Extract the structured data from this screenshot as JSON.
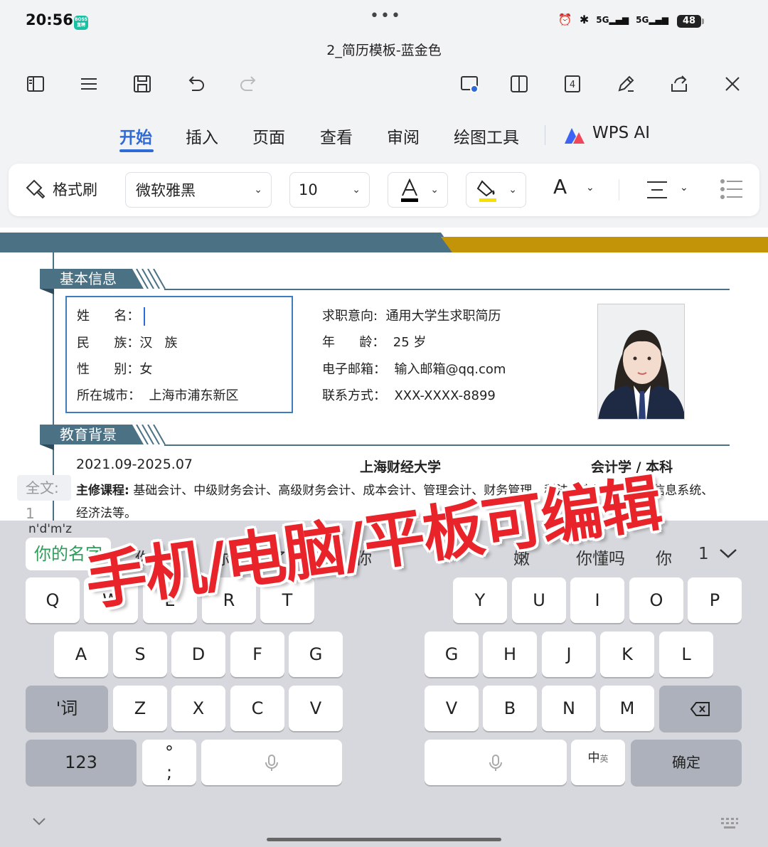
{
  "status": {
    "time": "20:56",
    "app_badge": "BOSS直聘",
    "battery": "48",
    "signal1": "5G",
    "signal2": "5G"
  },
  "document_title": "2_简历模板-蓝金色",
  "toolbar": {
    "left_icons": [
      "sidebar-icon",
      "menu-icon",
      "save-icon",
      "undo-icon",
      "redo-icon"
    ],
    "right_icons": [
      "screen-share-icon",
      "split-view-icon",
      "tab-count-icon",
      "pen-icon",
      "share-icon",
      "close-icon"
    ],
    "tab_count": "4"
  },
  "tabs": [
    {
      "label": "开始",
      "active": true
    },
    {
      "label": "插入",
      "active": false
    },
    {
      "label": "页面",
      "active": false
    },
    {
      "label": "查看",
      "active": false
    },
    {
      "label": "审阅",
      "active": false
    },
    {
      "label": "绘图工具",
      "active": false
    }
  ],
  "wps_ai_label": "WPS AI",
  "format": {
    "brush_label": "格式刷",
    "font": "微软雅黑",
    "size": "10",
    "font_color": "#000000",
    "highlight_color": "#f5e000",
    "text_a": "A"
  },
  "resume": {
    "section1": "基本信息",
    "section2": "教育背景",
    "name_row": "姓      名：",
    "ethnic_row": "民      族：汉   族",
    "gender_row": "性      别：女",
    "city_row": "所在城市：  上海市浦东新区",
    "job_row": "求职意向:  通用大学生求职简历",
    "age_row": "年      龄：  25 岁",
    "email_row": "电子邮箱：  输入邮箱@qq.com",
    "phone_row": "联系方式：  XXX-XXXX-8899",
    "edu_date": "2021.09-2025.07",
    "edu_school": "上海财经大学",
    "edu_major": "会计学  /  本科",
    "courses_label": "主修课程:",
    "courses_text": " 基础会计、中级财务会计、高级财务会计、成本会计、管理会计、财务管理、税法、审计学、会计信息系统、经济法等。",
    "fulltext_label": "全文: 1"
  },
  "keyboard": {
    "pinyin": "n'd'm'z",
    "candidates": [
      "你的名字",
      "你的",
      "你",
      "了",
      "你",
      "嫩",
      "你懂吗",
      "你",
      "1"
    ],
    "row1": [
      "Q",
      "W",
      "E",
      "R",
      "T",
      "Y",
      "U",
      "I",
      "O",
      "P"
    ],
    "row2": [
      "A",
      "S",
      "D",
      "F",
      "G",
      "G",
      "H",
      "J",
      "K",
      "L"
    ],
    "row3": [
      "Z",
      "X",
      "C",
      "V",
      "V",
      "B",
      "N",
      "M"
    ],
    "word_key": "'词",
    "num_key": "123",
    "punct_key": "°\n;",
    "lang_key": "中",
    "lang_sub": "英",
    "confirm_key": "确定"
  },
  "overlay_text": "手机/电脑/平板可编辑"
}
